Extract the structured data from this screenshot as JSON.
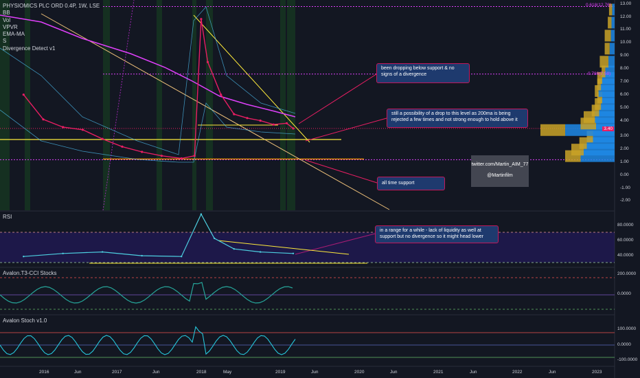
{
  "legend": {
    "symbol_line": "PHYSIOMICS PLC ORD 0.4P, 1W, LSE",
    "indicators": [
      "BB",
      "Vol",
      "VPVR",
      "EMA-MA",
      "S",
      "Divergence Detect v1"
    ]
  },
  "panes": {
    "rsi_title": "RSI",
    "t3cci_title": "Avalon.T3-CCI Stocks",
    "stoch_title": "Avalon Stoch v1.0"
  },
  "annotations": {
    "support_note": "been dropping below support & no signs of a divergence",
    "ma_note": "still a possibility of a drop to this level as 200ma is being rejected a few times and not strong enough to hold above it",
    "ats_note": "all time support",
    "rsi_note": "in a range for a while - lack of liquidity as well at support but no divergence so it might head lower",
    "twitter_handle": "twitter.com/Martin_AIM_77",
    "twitter_name": "@Martinfilm"
  },
  "price_axis": {
    "ticks": [
      "13.00",
      "12.00",
      "11.00",
      "10.00",
      "9.00",
      "8.00",
      "7.00",
      "6.00",
      "5.00",
      "4.00",
      "3.00",
      "2.00",
      "1.00",
      "0.00",
      "-1.00",
      "-2.00"
    ],
    "fib_top_label": "0.618(12.76)",
    "fib_mid_label": "0.786(7.58)",
    "current_price": "3.40"
  },
  "rsi_axis": {
    "ticks": [
      "80.0000",
      "60.0000",
      "40.0000"
    ]
  },
  "t3cci_axis": {
    "ticks": [
      "200.0000",
      "0.0000"
    ]
  },
  "stoch_axis": {
    "ticks": [
      "100.0000",
      "0.0000",
      "-100.0000"
    ]
  },
  "time_axis": {
    "labels": [
      "2016",
      "Jun",
      "2017",
      "Jun",
      "2018",
      "May",
      "2019",
      "Jun",
      "2020",
      "Jun",
      "2021",
      "Jun",
      "2022",
      "Jun",
      "2023"
    ]
  },
  "colors": {
    "background": "#131722",
    "price_line": "#e91e63",
    "support_yellow": "#ffeb3b",
    "all_time_support": "#ff9800",
    "ma_magenta": "#e040fb",
    "rsi_line": "#4dd0e1",
    "vpvr_up": "#1e88e5",
    "vpvr_down": "#c9a227"
  },
  "chart_data": {
    "type": "line",
    "title": "PHYSIOMICS PLC ORD 0.4P, 1W, LSE",
    "ylim": [
      -2.5,
      13.2
    ],
    "y_ticks": [
      13,
      12,
      11,
      10,
      9,
      8,
      7,
      6,
      5,
      4,
      3,
      2,
      1,
      0,
      -1,
      -2
    ],
    "current_price": 3.4,
    "fib_levels": [
      {
        "label": "0.618(12.76)",
        "value": 12.76
      },
      {
        "label": "0.786(7.58)",
        "value": 7.58
      }
    ],
    "support_levels": [
      2.5,
      1.0
    ],
    "x_dates": [
      "2015-10",
      "2016-01",
      "2016-04",
      "2016-07",
      "2016-10",
      "2017-01",
      "2017-04",
      "2017-07",
      "2017-10",
      "2017-12",
      "2018-01",
      "2018-02",
      "2018-04",
      "2018-06",
      "2018-08",
      "2018-10",
      "2018-12",
      "2019-02",
      "2019-03"
    ],
    "series": [
      {
        "values": [
          6.0,
          4.1,
          3.5,
          3.3,
          2.6,
          2.0,
          1.6,
          1.3,
          1.1,
          1.3,
          11.8,
          8.5,
          6.0,
          4.5,
          4.2,
          4.0,
          3.7,
          3.8,
          3.4
        ]
      }
    ],
    "vpvr": {
      "price_bins": [
        1.25,
        1.75,
        2.25,
        2.75,
        3.25,
        3.75,
        4.25,
        4.75,
        5.25,
        5.75,
        6.25,
        6.75,
        7.25,
        7.75,
        8.5,
        9.5,
        10.5,
        11.5,
        12.5
      ],
      "up_volume": [
        55,
        50,
        45,
        35,
        80,
        30,
        32,
        25,
        22,
        20,
        26,
        22,
        20,
        15,
        10,
        8,
        6,
        5,
        4
      ],
      "down_volume": [
        25,
        20,
        12,
        10,
        40,
        25,
        18,
        12,
        10,
        8,
        6,
        6,
        8,
        6,
        14,
        8,
        10,
        6,
        5
      ]
    },
    "rsi": {
      "ylim": [
        25,
        100
      ],
      "y_ticks": [
        80,
        60,
        40
      ],
      "x_dates": [
        "2015-10",
        "2016-04",
        "2016-10",
        "2017-04",
        "2017-10",
        "2018-01",
        "2018-03",
        "2018-06",
        "2018-10",
        "2019-03"
      ],
      "values": [
        38,
        42,
        44,
        39,
        38,
        94,
        62,
        48,
        44,
        42
      ]
    }
  }
}
